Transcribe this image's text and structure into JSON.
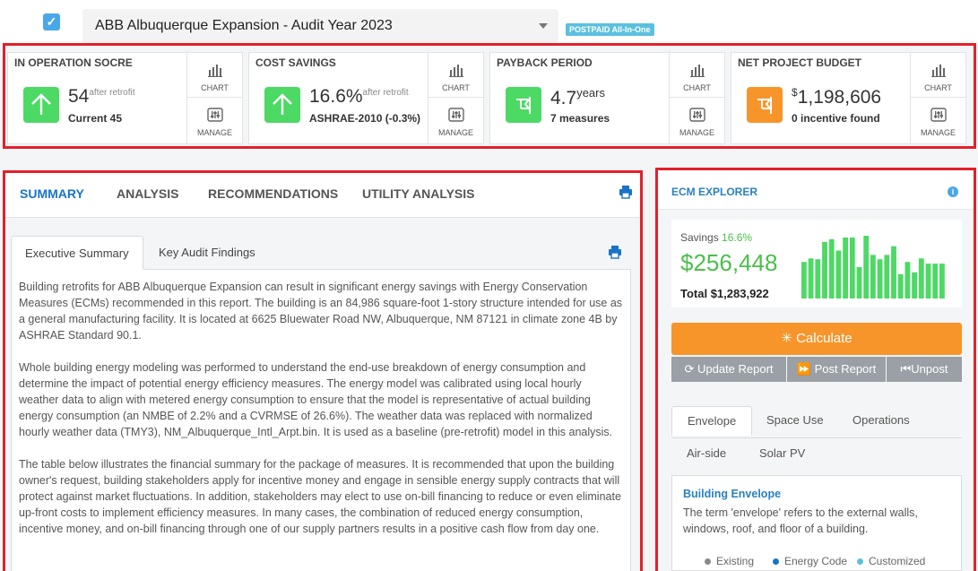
{
  "header": {
    "project_name": "ABB Albuquerque Expansion - Audit Year 2023",
    "plan_badge": "POSTPAID All-In-One"
  },
  "kpis": [
    {
      "title": "IN OPERATION SOCRE",
      "value": "54",
      "value_sup": "after retrofit",
      "sub": "Current 45",
      "icon": "arrow-up-icon",
      "icon_color": "#4cd964",
      "chart_label": "CHART",
      "manage_label": "MANAGE"
    },
    {
      "title": "COST SAVINGS",
      "value": "16.6%",
      "value_sup": "after retrofit",
      "sub": "ASHRAE-2010 (-0.3%)",
      "icon": "arrow-up-icon",
      "icon_color": "#4cd964",
      "chart_label": "CHART",
      "manage_label": "MANAGE"
    },
    {
      "title": "PAYBACK PERIOD",
      "value": "4.7",
      "value_sup": "years",
      "sub": "7 measures",
      "icon": "flag-icon",
      "icon_color": "#4cd964",
      "chart_label": "CHART",
      "manage_label": "MANAGE"
    },
    {
      "title": "NET PROJECT BUDGET",
      "value": "1,198,606",
      "value_pre": "$",
      "sub": "0 incentive found",
      "icon": "flag-icon",
      "icon_color": "#f7952b",
      "chart_label": "CHART",
      "manage_label": "MANAGE"
    }
  ],
  "report": {
    "tabs": [
      "SUMMARY",
      "ANALYSIS",
      "RECOMMENDATIONS",
      "UTILITY ANALYSIS"
    ],
    "active_tab": "SUMMARY",
    "subtabs": [
      "Executive Summary",
      "Key Audit Findings"
    ],
    "paragraphs": [
      "Building retrofits for ABB Albuquerque Expansion can result in significant energy savings with Energy Conservation Measures (ECMs) recommended in this report. The building is an 84,986 square-foot 1-story structure intended for use as a general manufacturing facility. It is located at 6625 Bluewater Road NW, Albuquerque, NM 87121 in climate zone 4B by ASHRAE Standard 90.1.",
      "Whole building energy modeling was performed to understand the end-use breakdown of energy consumption and determine the impact of potential energy efficiency measures. The energy model was calibrated using local hourly weather data to align with metered energy consumption to ensure that the model is representative of actual building energy consumption (an NMBE of 2.2% and a CVRMSE of 26.6%). The weather data was replaced with normalized hourly weather data (TMY3), NM_Albuquerque_Intl_Arpt.bin. It is used as a baseline (pre-retrofit) model in this analysis.",
      "The table below illustrates the financial summary for the package of measures. It is recommended that upon the building owner's request, building stakeholders apply for incentive money and engage in sensible energy supply contracts that will protect against market fluctuations. In addition, stakeholders may elect to use on-bill financing to reduce or even eliminate up-front costs to implement efficiency measures. In many cases, the combination of reduced energy consumption, incentive money, and on-bill financing through one of our supply partners results in a positive cash flow from day one."
    ]
  },
  "ecm": {
    "title": "ECM EXPLORER",
    "savings_label": "Savings",
    "savings_pct": "16.6%",
    "savings_amount": "$256,448",
    "total_label": "Total $1,283,922",
    "bars": [
      42,
      46,
      45,
      65,
      68,
      55,
      70,
      70,
      36,
      72,
      50,
      45,
      50,
      60,
      28,
      42,
      30,
      46,
      40,
      40,
      40
    ],
    "calculate_label": "✳ Calculate",
    "update_label": "Update Report",
    "post_label": "Post Report",
    "unpost_label": "Unpost",
    "category_tabs": [
      "Envelope",
      "Space Use",
      "Operations",
      "Air-side",
      "Solar PV"
    ],
    "active_category": "Envelope",
    "section_title": "Building Envelope",
    "section_desc": "The term 'envelope' refers to the external walls, windows, roof, and floor of a building.",
    "legend": [
      {
        "label": "Existing",
        "color": "#888888"
      },
      {
        "label": "Energy Code",
        "color": "#1a73c8"
      },
      {
        "label": "Customized",
        "color": "#5bc0de"
      }
    ]
  }
}
